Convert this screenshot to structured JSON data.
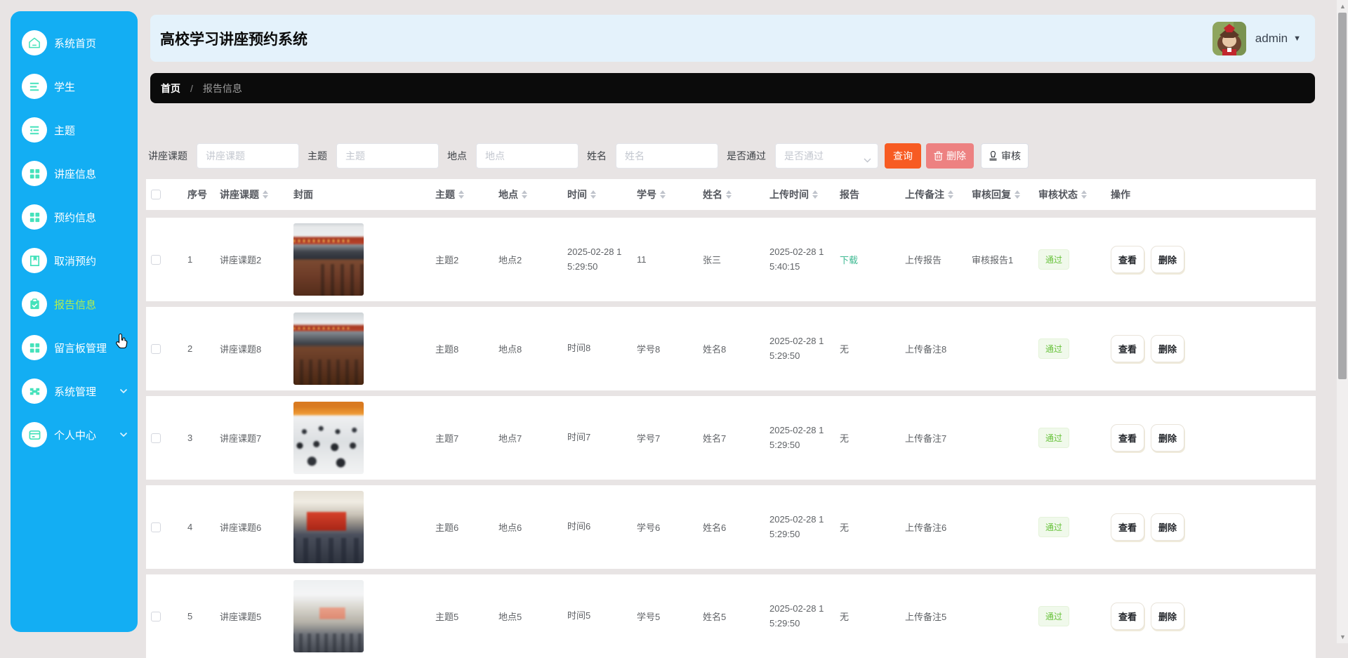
{
  "app": {
    "title": "高校学习讲座预约系统",
    "user": "admin"
  },
  "sidebar": {
    "items": [
      {
        "label": "系统首页",
        "icon": "home-icon",
        "active": false,
        "expandable": false
      },
      {
        "label": "学生",
        "icon": "list-icon",
        "active": false,
        "expandable": false
      },
      {
        "label": "主题",
        "icon": "menu-fold-icon",
        "active": false,
        "expandable": false
      },
      {
        "label": "讲座信息",
        "icon": "grid-icon",
        "active": false,
        "expandable": false
      },
      {
        "label": "预约信息",
        "icon": "grid-icon",
        "active": false,
        "expandable": false
      },
      {
        "label": "取消预约",
        "icon": "book-icon",
        "active": false,
        "expandable": false
      },
      {
        "label": "报告信息",
        "icon": "clipboard-check-icon",
        "active": true,
        "expandable": false
      },
      {
        "label": "留言板管理",
        "icon": "grid-icon",
        "active": false,
        "expandable": false
      },
      {
        "label": "系统管理",
        "icon": "components-icon",
        "active": false,
        "expandable": true
      },
      {
        "label": "个人中心",
        "icon": "idcard-icon",
        "active": false,
        "expandable": true
      }
    ]
  },
  "breadcrumb": {
    "home": "首页",
    "separator": "/",
    "current": "报告信息"
  },
  "filters": {
    "fields": [
      {
        "label": "讲座课题",
        "placeholder": "讲座课题",
        "type": "input"
      },
      {
        "label": "主题",
        "placeholder": "主题",
        "type": "input"
      },
      {
        "label": "地点",
        "placeholder": "地点",
        "type": "input"
      },
      {
        "label": "姓名",
        "placeholder": "姓名",
        "type": "input"
      },
      {
        "label": "是否通过",
        "placeholder": "是否通过",
        "type": "select"
      }
    ],
    "buttons": {
      "search": "查询",
      "delete": "删除",
      "review": "审核"
    }
  },
  "table": {
    "columns": [
      {
        "label": "序号",
        "sortable": false
      },
      {
        "label": "讲座课题",
        "sortable": true
      },
      {
        "label": "封面",
        "sortable": false
      },
      {
        "label": "主题",
        "sortable": true
      },
      {
        "label": "地点",
        "sortable": true
      },
      {
        "label": "时间",
        "sortable": true
      },
      {
        "label": "学号",
        "sortable": true
      },
      {
        "label": "姓名",
        "sortable": true
      },
      {
        "label": "上传时间",
        "sortable": true
      },
      {
        "label": "报告",
        "sortable": false
      },
      {
        "label": "上传备注",
        "sortable": true
      },
      {
        "label": "审核回复",
        "sortable": true
      },
      {
        "label": "审核状态",
        "sortable": true
      },
      {
        "label": "操作",
        "sortable": false
      }
    ],
    "rows": [
      {
        "index": "1",
        "topic": "讲座课题2",
        "cover": "conference-room-photo",
        "subject": "主题2",
        "place": "地点2",
        "time": "2025-02-28 15:29:50",
        "student_no": "11",
        "name": "张三",
        "upload_time": "2025-02-28 15:40:15",
        "report": "下载",
        "report_link": true,
        "remark": "上传报告",
        "reply": "审核报告1",
        "status": "通过",
        "actions": [
          "查看",
          "删除"
        ]
      },
      {
        "index": "2",
        "topic": "讲座课题8",
        "cover": "conference-room-photo",
        "subject": "主题8",
        "place": "地点8",
        "time": "时间8",
        "student_no": "学号8",
        "name": "姓名8",
        "upload_time": "2025-02-28 15:29:50",
        "report": "无",
        "report_link": false,
        "remark": "上传备注8",
        "reply": "",
        "status": "通过",
        "actions": [
          "查看",
          "删除"
        ]
      },
      {
        "index": "3",
        "topic": "讲座课题7",
        "cover": "lecture-audience-photo",
        "subject": "主题7",
        "place": "地点7",
        "time": "时间7",
        "student_no": "学号7",
        "name": "姓名7",
        "upload_time": "2025-02-28 15:29:50",
        "report": "无",
        "report_link": false,
        "remark": "上传备注7",
        "reply": "",
        "status": "通过",
        "actions": [
          "查看",
          "删除"
        ]
      },
      {
        "index": "4",
        "topic": "讲座课题6",
        "cover": "conference-hall-photo",
        "subject": "主题6",
        "place": "地点6",
        "time": "时间6",
        "student_no": "学号6",
        "name": "姓名6",
        "upload_time": "2025-02-28 15:29:50",
        "report": "无",
        "report_link": false,
        "remark": "上传备注6",
        "reply": "",
        "status": "通过",
        "actions": [
          "查看",
          "删除"
        ]
      },
      {
        "index": "5",
        "topic": "讲座课题5",
        "cover": "lecture-hall-photo",
        "subject": "主题5",
        "place": "地点5",
        "time": "时间5",
        "student_no": "学号5",
        "name": "姓名5",
        "upload_time": "2025-02-28 15:29:50",
        "report": "无",
        "report_link": false,
        "remark": "上传备注5",
        "reply": "",
        "status": "通过",
        "actions": [
          "查看",
          "删除"
        ]
      }
    ]
  },
  "colors": {
    "sidebar": "#13aef3",
    "sidebar_icon": "#45e2bb",
    "active_item": "#b2ee4e",
    "search_button": "#f75b22",
    "delete_button": "#ed8181",
    "status_pass_bg": "#f0f9eb",
    "status_pass_text": "#67c23a",
    "download_link": "#3eb992"
  }
}
